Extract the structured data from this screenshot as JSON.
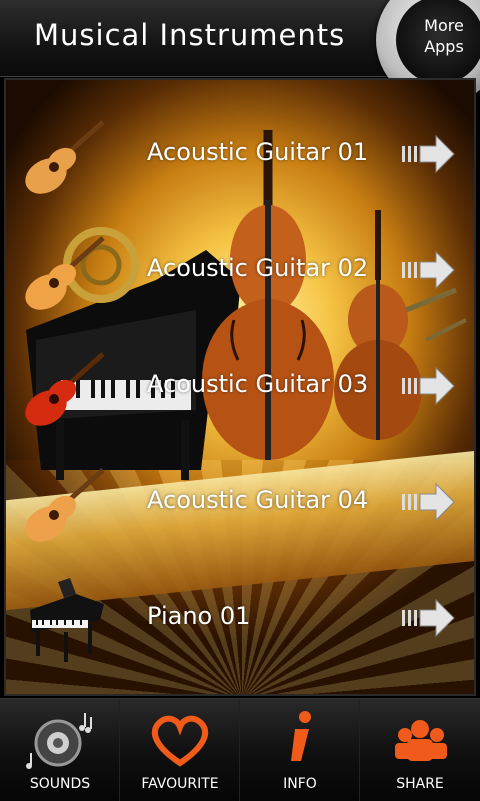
{
  "header": {
    "title": "Musical Instruments",
    "more_apps_label": "More\nApps"
  },
  "list": {
    "items": [
      {
        "label": "Acoustic Guitar 01",
        "icon": "acoustic-guitar-icon"
      },
      {
        "label": "Acoustic Guitar 02",
        "icon": "acoustic-guitar-icon"
      },
      {
        "label": "Acoustic Guitar 03",
        "icon": "red-guitar-icon"
      },
      {
        "label": "Acoustic Guitar 04",
        "icon": "acoustic-guitar-icon"
      },
      {
        "label": "Piano 01",
        "icon": "grand-piano-icon"
      }
    ]
  },
  "tabs": [
    {
      "label": "SOUNDS",
      "icon": "speaker-notes-icon"
    },
    {
      "label": "FAVOURITE",
      "icon": "heart-icon"
    },
    {
      "label": "INFO",
      "icon": "info-icon"
    },
    {
      "label": "SHARE",
      "icon": "people-icon"
    }
  ],
  "colors": {
    "accent_orange": "#f05a1a",
    "header_bg": "#1a1a1a",
    "stage_glow": "#f6c445"
  }
}
